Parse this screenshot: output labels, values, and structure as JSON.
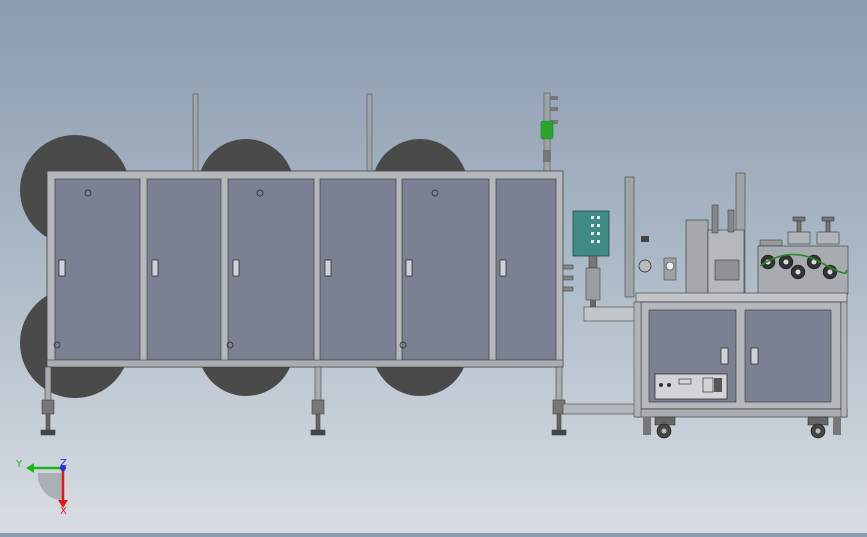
{
  "viewport": {
    "background_top": "#8b9bb0",
    "background_bottom": "#d9dde3"
  },
  "machine": {
    "frame_color": "#b4b8bc",
    "panel_color": "#7b8092",
    "reel_color": "#4a4a4a",
    "console_color": "#3f8a84",
    "pneumatic_accent": "#2aa52a",
    "panel_count": 6,
    "reels_per_row": 3
  },
  "triad": {
    "x_label": "X",
    "y_label": "Y",
    "z_label": "Z",
    "x_color": "#e01818",
    "y_color": "#18b818",
    "z_color": "#2030e0"
  }
}
